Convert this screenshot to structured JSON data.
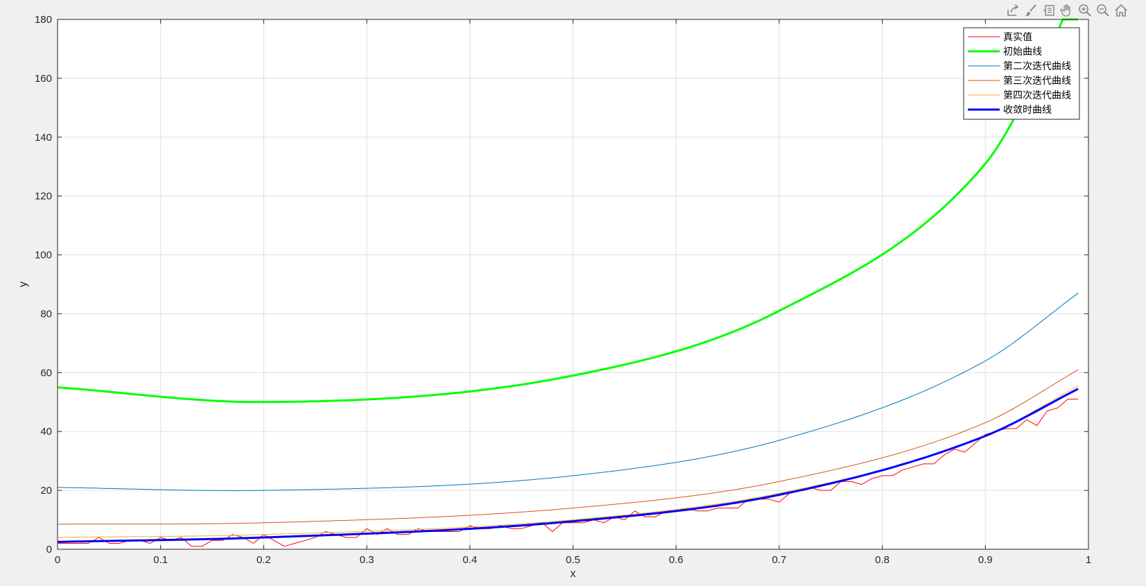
{
  "toolbar": {
    "buttons": [
      {
        "name": "export-icon"
      },
      {
        "name": "brush-icon"
      },
      {
        "name": "datatip-icon"
      },
      {
        "name": "pan-icon"
      },
      {
        "name": "zoom-in-icon"
      },
      {
        "name": "zoom-out-icon"
      },
      {
        "name": "home-icon"
      }
    ]
  },
  "chart_data": {
    "type": "line",
    "title": "",
    "xlabel": "x",
    "ylabel": "y",
    "xlim": [
      0,
      1
    ],
    "ylim": [
      0,
      180
    ],
    "xticks": [
      0,
      0.1,
      0.2,
      0.3,
      0.4,
      0.5,
      0.6,
      0.7,
      0.8,
      0.9,
      1
    ],
    "xtick_labels": [
      "0",
      "0.1",
      "0.2",
      "0.3",
      "0.4",
      "0.5",
      "0.6",
      "0.7",
      "0.8",
      "0.9",
      "1"
    ],
    "yticks": [
      0,
      20,
      40,
      60,
      80,
      100,
      120,
      140,
      160,
      180
    ],
    "ytick_labels": [
      "0",
      "20",
      "40",
      "60",
      "80",
      "100",
      "120",
      "140",
      "160",
      "180"
    ],
    "grid": true,
    "legend_position": "top-right",
    "series": [
      {
        "name": "真实值",
        "color": "#ff0000",
        "width": 1,
        "x": [
          0,
          0.01,
          0.02,
          0.03,
          0.04,
          0.05,
          0.06,
          0.07,
          0.08,
          0.09,
          0.1,
          0.11,
          0.12,
          0.13,
          0.14,
          0.15,
          0.16,
          0.17,
          0.18,
          0.19,
          0.2,
          0.21,
          0.22,
          0.23,
          0.24,
          0.25,
          0.26,
          0.27,
          0.28,
          0.29,
          0.3,
          0.31,
          0.32,
          0.33,
          0.34,
          0.35,
          0.36,
          0.37,
          0.38,
          0.39,
          0.4,
          0.41,
          0.42,
          0.43,
          0.44,
          0.45,
          0.46,
          0.47,
          0.48,
          0.49,
          0.5,
          0.51,
          0.52,
          0.53,
          0.54,
          0.55,
          0.56,
          0.57,
          0.58,
          0.59,
          0.6,
          0.61,
          0.62,
          0.63,
          0.64,
          0.65,
          0.66,
          0.67,
          0.68,
          0.69,
          0.7,
          0.71,
          0.72,
          0.73,
          0.74,
          0.75,
          0.76,
          0.77,
          0.78,
          0.79,
          0.8,
          0.81,
          0.82,
          0.83,
          0.84,
          0.85,
          0.86,
          0.87,
          0.88,
          0.89,
          0.9,
          0.91,
          0.92,
          0.93,
          0.94,
          0.95,
          0.96,
          0.97,
          0.98,
          0.99
        ],
        "y": [
          2,
          2,
          2,
          2,
          4,
          2,
          2,
          3,
          3,
          2,
          4,
          3,
          4,
          1,
          1,
          3,
          3,
          5,
          4,
          2,
          5,
          3,
          1,
          2,
          3,
          4,
          6,
          5,
          4,
          4,
          7,
          5,
          7,
          5,
          5,
          7,
          6,
          6,
          6,
          6,
          8,
          7,
          7,
          8,
          7,
          7,
          8,
          9,
          6,
          9,
          9,
          9,
          10,
          9,
          11,
          10,
          13,
          11,
          11,
          13,
          13,
          14,
          13,
          13,
          14,
          14,
          14,
          17,
          17,
          17,
          16,
          19,
          20,
          21,
          20,
          20,
          23,
          23,
          22,
          24,
          25,
          25,
          27,
          28,
          29,
          29,
          32,
          34,
          33,
          36,
          39,
          40,
          41,
          41,
          44,
          42,
          47,
          48,
          51,
          51
        ]
      },
      {
        "name": "初始曲线",
        "color": "#00ff00",
        "width": 3,
        "formula": "initial",
        "y_samples": {
          "0": 55,
          "0.2": 50,
          "0.5": 59,
          "0.7": 81,
          "0.9": 131,
          "0.95": 160
        }
      },
      {
        "name": "第二次迭代曲线",
        "color": "#0072bd",
        "width": 1,
        "y_samples": {
          "0": 21,
          "0.2": 20,
          "0.5": 25,
          "0.7": 37,
          "0.9": 64,
          "0.99": 87
        }
      },
      {
        "name": "第三次迭代曲线",
        "color": "#d95319",
        "width": 1,
        "y_samples": {
          "0": 8.5,
          "0.2": 9,
          "0.5": 14,
          "0.7": 23,
          "0.9": 43,
          "0.99": 61
        }
      },
      {
        "name": "第四次迭代曲线",
        "color": "#edb120",
        "width": 1,
        "y_samples": {
          "0": 4,
          "0.2": 5,
          "0.5": 10,
          "0.7": 19,
          "0.9": 38.5,
          "0.99": 55.5
        }
      },
      {
        "name": "收敛时曲线",
        "color": "#0000ff",
        "width": 3,
        "y_samples": {
          "0": 2.5,
          "0.2": 4,
          "0.5": 9.5,
          "0.7": 18.5,
          "0.9": 38.5,
          "0.99": 54.5
        }
      }
    ]
  }
}
